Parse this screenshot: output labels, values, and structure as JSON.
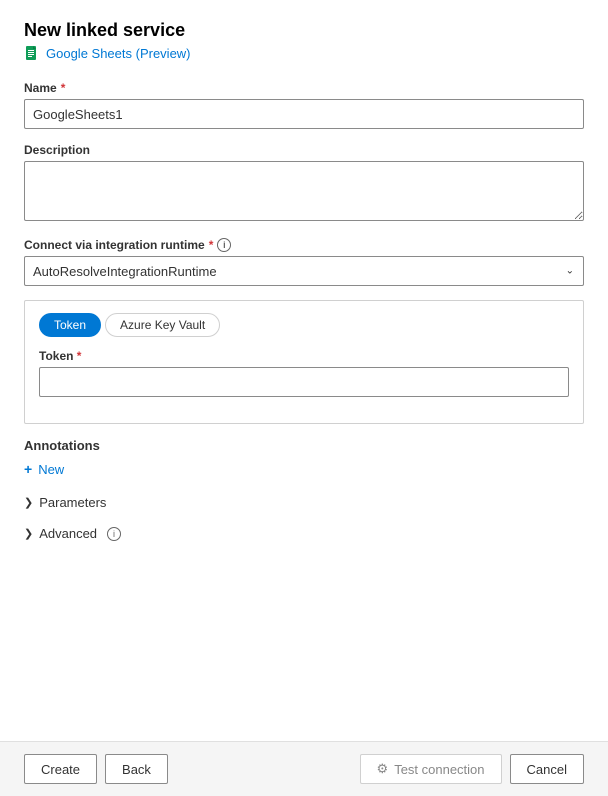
{
  "header": {
    "title": "New linked service",
    "subtitle": "Google Sheets (Preview)"
  },
  "form": {
    "name_label": "Name",
    "name_value": "GoogleSheets1",
    "description_label": "Description",
    "description_placeholder": "",
    "integration_runtime_label": "Connect via integration runtime",
    "integration_runtime_value": "AutoResolveIntegrationRuntime",
    "integration_runtime_options": [
      "AutoResolveIntegrationRuntime"
    ]
  },
  "auth": {
    "token_tab_label": "Token",
    "azure_key_vault_tab_label": "Azure Key Vault",
    "token_field_label": "Token",
    "token_value": ""
  },
  "annotations": {
    "section_label": "Annotations",
    "new_label": "New"
  },
  "parameters": {
    "section_label": "Parameters"
  },
  "advanced": {
    "section_label": "Advanced"
  },
  "footer": {
    "create_label": "Create",
    "back_label": "Back",
    "test_connection_label": "Test connection",
    "cancel_label": "Cancel"
  },
  "icons": {
    "info": "i",
    "chevron_right": "›",
    "plus": "+",
    "test_connection_icon": "⚙"
  }
}
